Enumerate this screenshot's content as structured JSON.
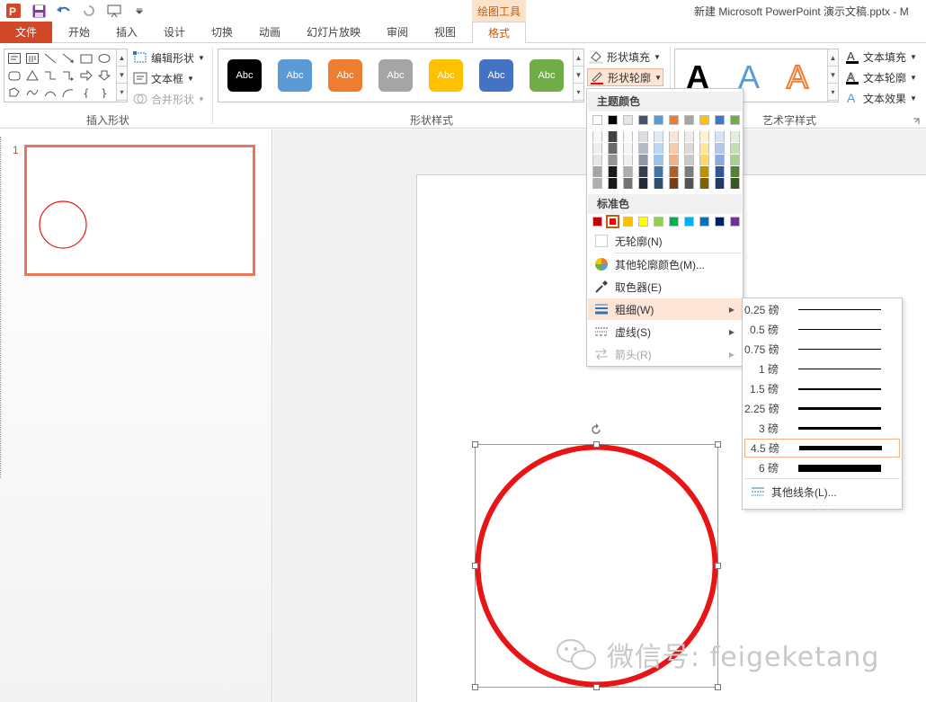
{
  "app": {
    "context_tab_title": "绘图工具",
    "doc_title": "新建 Microsoft PowerPoint 演示文稿.pptx - M"
  },
  "tabs": [
    "文件",
    "开始",
    "插入",
    "设计",
    "切换",
    "动画",
    "幻灯片放映",
    "审阅",
    "视图",
    "格式"
  ],
  "active_tab": "格式",
  "ribbon": {
    "insert_shapes": {
      "edit_shape": "编辑形状",
      "text_box": "文本框",
      "merge_shapes": "合并形状",
      "group_label": "插入形状"
    },
    "shape_styles": {
      "swatch_text": "Abc",
      "swatch_colors": [
        "#000000",
        "#5b9bd5",
        "#ed7d31",
        "#a5a5a5",
        "#ffc000",
        "#4472c4",
        "#70ad47"
      ],
      "shape_fill": "形状填充",
      "shape_outline": "形状轮廓",
      "group_label": "形状样式"
    },
    "wordart": {
      "glyph": "A",
      "text_fill": "文本填充",
      "text_outline": "文本轮廓",
      "text_effects": "文本效果",
      "group_label": "艺术字样式"
    }
  },
  "thumbnail": {
    "slide_number": "1"
  },
  "outline_menu": {
    "theme_colors_label": "主题颜色",
    "theme_colors_top": [
      "#ffffff",
      "#000000",
      "#e7e6e6",
      "#44546a",
      "#5b9bd5",
      "#ed7d31",
      "#a5a5a5",
      "#ffc000",
      "#4472c4",
      "#70ad47"
    ],
    "standard_colors_label": "标准色",
    "standard_colors": [
      "#c00000",
      "#ff0000",
      "#ffc000",
      "#ffff00",
      "#92d050",
      "#00b050",
      "#00b0f0",
      "#0070c0",
      "#002060",
      "#7030a0"
    ],
    "selected_standard_color": "#ff0000",
    "no_outline": "无轮廓(N)",
    "more_colors": "其他轮廓颜色(M)...",
    "eyedropper": "取色器(E)",
    "weight": "粗细(W)",
    "dashes": "虚线(S)",
    "arrows": "箭头(R)"
  },
  "weight_menu": {
    "options": [
      "0.25 磅",
      "0.5 磅",
      "0.75 磅",
      "1 磅",
      "1.5 磅",
      "2.25 磅",
      "3 磅",
      "4.5 磅",
      "6 磅"
    ],
    "selected": "4.5 磅",
    "more_lines": "其他线条(L)..."
  },
  "canvas": {
    "circle_color": "#e81416",
    "watermark": "微信号: feigeketang"
  }
}
